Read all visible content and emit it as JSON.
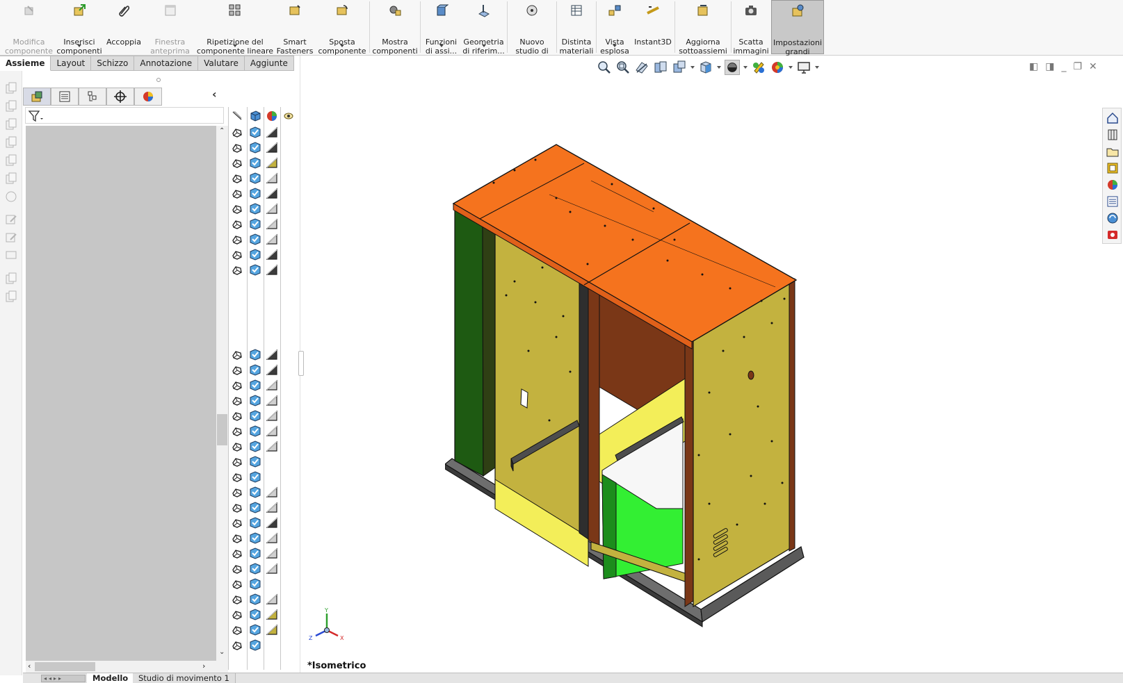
{
  "ribbon": {
    "buttons": [
      {
        "label": "Modifica\ncomponente",
        "icon": "edit-component-icon",
        "enabled": false,
        "dropdown": false
      },
      {
        "label": "Inserisci\ncomponenti",
        "icon": "insert-components-icon",
        "enabled": true,
        "dropdown": true
      },
      {
        "label": "Accoppia",
        "icon": "mate-paperclip-icon",
        "enabled": true,
        "dropdown": false
      },
      {
        "label": "Finestra\nanteprima\ncomponente",
        "icon": "component-preview-icon",
        "enabled": false,
        "dropdown": false
      },
      {
        "label": "Ripetizione del\ncomponente lineare",
        "icon": "linear-pattern-icon",
        "enabled": true,
        "dropdown": true
      },
      {
        "label": "Smart\nFasteners",
        "icon": "smart-fasteners-icon",
        "enabled": true,
        "dropdown": false
      },
      {
        "label": "Sposta\ncomponente",
        "icon": "move-component-icon",
        "enabled": true,
        "dropdown": true
      },
      {
        "label": "Mostra\ncomponenti\nnascosti",
        "icon": "show-hidden-icon",
        "enabled": true,
        "dropdown": false
      },
      {
        "label": "Funzioni\ndi assi...",
        "icon": "assembly-features-icon",
        "enabled": true,
        "dropdown": true
      },
      {
        "label": "Geometria\ndi riferim...",
        "icon": "reference-geometry-icon",
        "enabled": true,
        "dropdown": true
      },
      {
        "label": "Nuovo\nstudio di\nmovimento",
        "icon": "motion-study-icon",
        "enabled": true,
        "dropdown": false
      },
      {
        "label": "Distinta\nmateriali",
        "icon": "bill-of-materials-icon",
        "enabled": true,
        "dropdown": false
      },
      {
        "label": "Vista\nesplosa",
        "icon": "exploded-view-icon",
        "enabled": true,
        "dropdown": true
      },
      {
        "label": "Instant3D",
        "icon": "instant3d-icon",
        "enabled": true,
        "dropdown": false
      },
      {
        "label": "Aggiorna\nsottoassiemi\ndi SpeedPak",
        "icon": "speedpak-update-icon",
        "enabled": true,
        "dropdown": false
      },
      {
        "label": "Scatta\nimmagini",
        "icon": "camera-icon",
        "enabled": true,
        "dropdown": false
      },
      {
        "label": "Impostazioni\ngrandi\nassiemi",
        "icon": "large-assembly-icon",
        "enabled": true,
        "dropdown": false,
        "active": true
      }
    ]
  },
  "tabs": [
    "Assieme",
    "Layout",
    "Schizzo",
    "Annotazione",
    "Valutare",
    "Aggiunte"
  ],
  "active_tab": "Assieme",
  "feature_manager": {
    "tab_icons": [
      "feature-tree-icon",
      "property-manager-icon",
      "configuration-manager-icon",
      "dimxpert-icon",
      "display-manager-icon"
    ],
    "collapse_glyph": "‹",
    "filter_icon": "filter-icon",
    "column_icons": [
      "suppress-column-icon",
      "part-column-icon",
      "appearance-column-icon",
      "visibility-column-icon"
    ]
  },
  "graphics": {
    "view_name": "*Isometrico",
    "triad": {
      "x": "X",
      "y": "Y",
      "z": "Z"
    },
    "colors": {
      "orange": "#f5731e",
      "olive": "#c1ae3e",
      "green": "#1e5a12",
      "brown": "#7a3717",
      "yellow": "#f3ee59",
      "lime": "#33ef33",
      "base": "#555555"
    }
  },
  "bottom_tabs": [
    "Modello",
    "Studio di movimento 1"
  ],
  "active_bottom_tab": "Modello"
}
